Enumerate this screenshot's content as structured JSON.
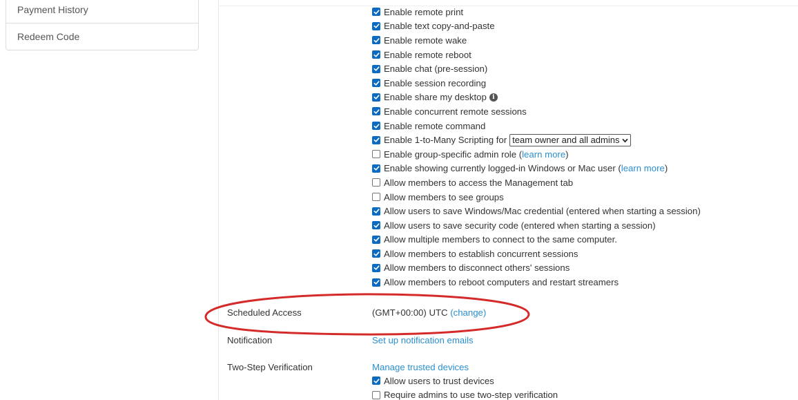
{
  "sidebar": {
    "items": [
      {
        "label": "Payment History"
      },
      {
        "label": "Redeem Code"
      }
    ]
  },
  "options": [
    {
      "checked": true,
      "text": "Enable remote print"
    },
    {
      "checked": true,
      "text": "Enable text copy-and-paste"
    },
    {
      "checked": true,
      "text": "Enable remote wake"
    },
    {
      "checked": true,
      "text": "Enable remote reboot"
    },
    {
      "checked": true,
      "text": "Enable chat (pre-session)"
    },
    {
      "checked": true,
      "text": "Enable session recording"
    },
    {
      "checked": true,
      "text": "Enable share my desktop",
      "icon": "info-icon"
    },
    {
      "checked": true,
      "text": "Enable concurrent remote sessions"
    },
    {
      "checked": true,
      "text": "Enable remote command"
    },
    {
      "checked": true,
      "text": "Enable 1-to-Many Scripting for",
      "select_value": "team owner and all admins"
    },
    {
      "checked": false,
      "text": "Enable group-specific admin role",
      "link": "learn more"
    },
    {
      "checked": true,
      "text": "Enable showing currently logged-in Windows or Mac user",
      "link": "learn more"
    },
    {
      "checked": false,
      "text": "Allow members to access the Management tab"
    },
    {
      "checked": false,
      "text": "Allow members to see groups"
    },
    {
      "checked": true,
      "text": "Allow users to save Windows/Mac credential (entered when starting a session)"
    },
    {
      "checked": true,
      "text": "Allow users to save security code (entered when starting a session)"
    },
    {
      "checked": true,
      "text": "Allow multiple members to connect to the same computer."
    },
    {
      "checked": true,
      "text": "Allow members to establish concurrent sessions"
    },
    {
      "checked": true,
      "text": "Allow members to disconnect others' sessions"
    },
    {
      "checked": true,
      "text": "Allow members to reboot computers and restart streamers"
    }
  ],
  "scheduled_access": {
    "label": "Scheduled Access",
    "value": "(GMT+00:00) UTC",
    "link": "(change)",
    "highlight_color": "#d42a2a"
  },
  "notification": {
    "label": "Notification",
    "link": "Set up notification emails"
  },
  "two_step": {
    "label": "Two-Step Verification",
    "link": "Manage trusted devices",
    "options": [
      {
        "checked": true,
        "text": "Allow users to trust devices"
      },
      {
        "checked": false,
        "text": "Require admins to use two-step verification"
      }
    ]
  },
  "colors": {
    "link": "#2a8fd0",
    "checkbox": "#0b6bc2",
    "text": "#333333"
  }
}
